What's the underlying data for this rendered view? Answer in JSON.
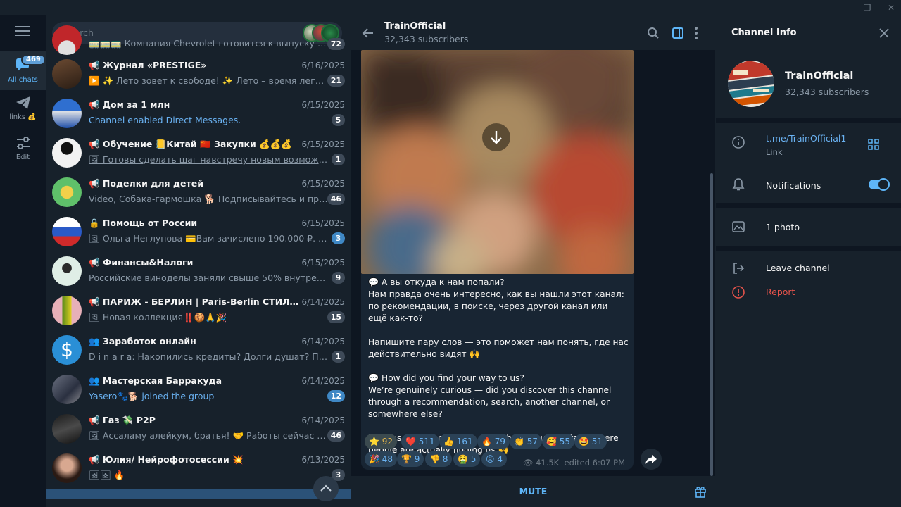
{
  "window": {
    "minimize": "—",
    "restore": "❐",
    "close": "✕"
  },
  "rail": {
    "all_chats_label": "All chats",
    "all_chats_badge": "469",
    "links_label": "links 💰",
    "edit_label": "Edit"
  },
  "search": {
    "placeholder": "Search"
  },
  "chats": [
    {
      "title": "",
      "preview": "🚃🚃🚃 Компания Chevrolet готовится к выпуску самого...",
      "date": "",
      "count": "72",
      "count_style": "gray",
      "preview_style": "normal"
    },
    {
      "title": "📢 Журнал «PRESTIGE»",
      "preview": "▶️ ✨ Лето зовет к свободе! ✨   Лето – время легкости...",
      "date": "6/16/2025",
      "count": "21",
      "count_style": "gray",
      "preview_style": "normal"
    },
    {
      "title": "📢 Дом за 1 млн",
      "preview": "Channel enabled Direct Messages.",
      "date": "6/15/2025",
      "count": "5",
      "count_style": "gray",
      "preview_style": "blue"
    },
    {
      "title": "📢 Обучение 📒Китай 🇨🇳 Закупки 💰💰💰",
      "preview": "🖼 Готовы сделать шаг навстречу новым возможностя...",
      "date": "6/15/2025",
      "count": "1",
      "count_style": "gray",
      "preview_style": "normal"
    },
    {
      "title": "📢 Поделки для детей",
      "preview": "Video, Собака-гармошка 🐕 Подписывайтесь и пригла...",
      "date": "6/15/2025",
      "count": "46",
      "count_style": "gray",
      "preview_style": "video"
    },
    {
      "title": "🔒 Помощь от России",
      "preview": "🖼 Ольга Неглупова 💳Вам зачислено 190.000 ₽. Балан...",
      "date": "6/15/2025",
      "count": "3",
      "count_style": "blue",
      "preview_style": "normal"
    },
    {
      "title": "📢 Финансы&Налоги",
      "preview": "Российские виноделы заняли свыше 50% внутреннего ...",
      "date": "6/15/2025",
      "count": "9",
      "count_style": "gray",
      "preview_style": "normal"
    },
    {
      "title": "📢 ПАРИЖ - БЕРЛИН | Paris-Berlin СТИЛЬНАЯ ЖЕ...",
      "preview": "🖼 Новая коллекция‼️🍪🙏🎉",
      "date": "6/14/2025",
      "count": "15",
      "count_style": "gray",
      "preview_style": "normal"
    },
    {
      "title": "👥 Заработок онлайн",
      "preview": "D i n a r a: Накопились кредиты? Долги душат? Прой...",
      "date": "6/14/2025",
      "count": "1",
      "count_style": "gray",
      "preview_style": "sender"
    },
    {
      "title": "👥 Мастерская Барракуда",
      "preview": "Yasero🐾🐕 joined the group",
      "date": "6/14/2025",
      "count": "12",
      "count_style": "blue",
      "preview_style": "blue"
    },
    {
      "title": "📢 Газ 💸 P2P",
      "preview": "🖼 Ассаламу алейкум, братья! 🤝 Работы сейчас навал...",
      "date": "6/14/2025",
      "count": "46",
      "count_style": "gray",
      "preview_style": "normal"
    },
    {
      "title": "📢 Юлия/ Нейрофотосессии 💥",
      "preview": "🖼🖼 🔥",
      "date": "6/13/2025",
      "count": "3",
      "count_style": "gray",
      "preview_style": "normal"
    }
  ],
  "header": {
    "name": "TrainOfficial",
    "subscribers": "32,343 subscribers"
  },
  "message": {
    "text": "💬 А вы откуда к нам попали?\nНам правда очень интересно, как вы нашли этот канал: по рекомендации, в поиске, через другой канал или ещё как-то?\n\nНапишите пару слов — это поможет нам понять, где нас действительно видят 🙌\n\n💬 How did you find your way to us?\nWe’re genuinely curious — did you discover this channel through a recommendation, search, another channel, or somewhere else?\n\nDrop us a quick message — it’ll help us understand where people are actually finding us 🙌",
    "reactions": [
      {
        "emoji": "⭐",
        "count": "92",
        "style": "gold"
      },
      {
        "emoji": "❤️",
        "count": "511",
        "style": "normal"
      },
      {
        "emoji": "👍",
        "count": "161",
        "style": "normal"
      },
      {
        "emoji": "🔥",
        "count": "79",
        "style": "normal"
      },
      {
        "emoji": "👏",
        "count": "57",
        "style": "normal"
      },
      {
        "emoji": "🥰",
        "count": "55",
        "style": "normal"
      },
      {
        "emoji": "🤩",
        "count": "51",
        "style": "normal"
      },
      {
        "emoji": "🎉",
        "count": "48",
        "style": "normal"
      },
      {
        "emoji": "🏆",
        "count": "9",
        "style": "normal"
      },
      {
        "emoji": "👎",
        "count": "8",
        "style": "normal"
      },
      {
        "emoji": "🤮",
        "count": "5",
        "style": "normal"
      },
      {
        "emoji": "😡",
        "count": "4",
        "style": "normal"
      }
    ],
    "views": "41.5K",
    "edited": "edited 6:07 PM"
  },
  "bottom": {
    "mute_label": "MUTE"
  },
  "info": {
    "title": "Channel Info",
    "name": "TrainOfficial",
    "subscribers": "32,343 subscribers",
    "link": "t.me/TrainOfficial1",
    "link_label": "Link",
    "notifications_label": "Notifications",
    "notifications_on": true,
    "photos_label": "1 photo",
    "leave_label": "Leave channel",
    "report_label": "Report"
  },
  "colors": {
    "accent": "#5eb5f7",
    "danger": "#e5534b",
    "bg": "#17212b",
    "chat_bg": "#0e1621"
  }
}
